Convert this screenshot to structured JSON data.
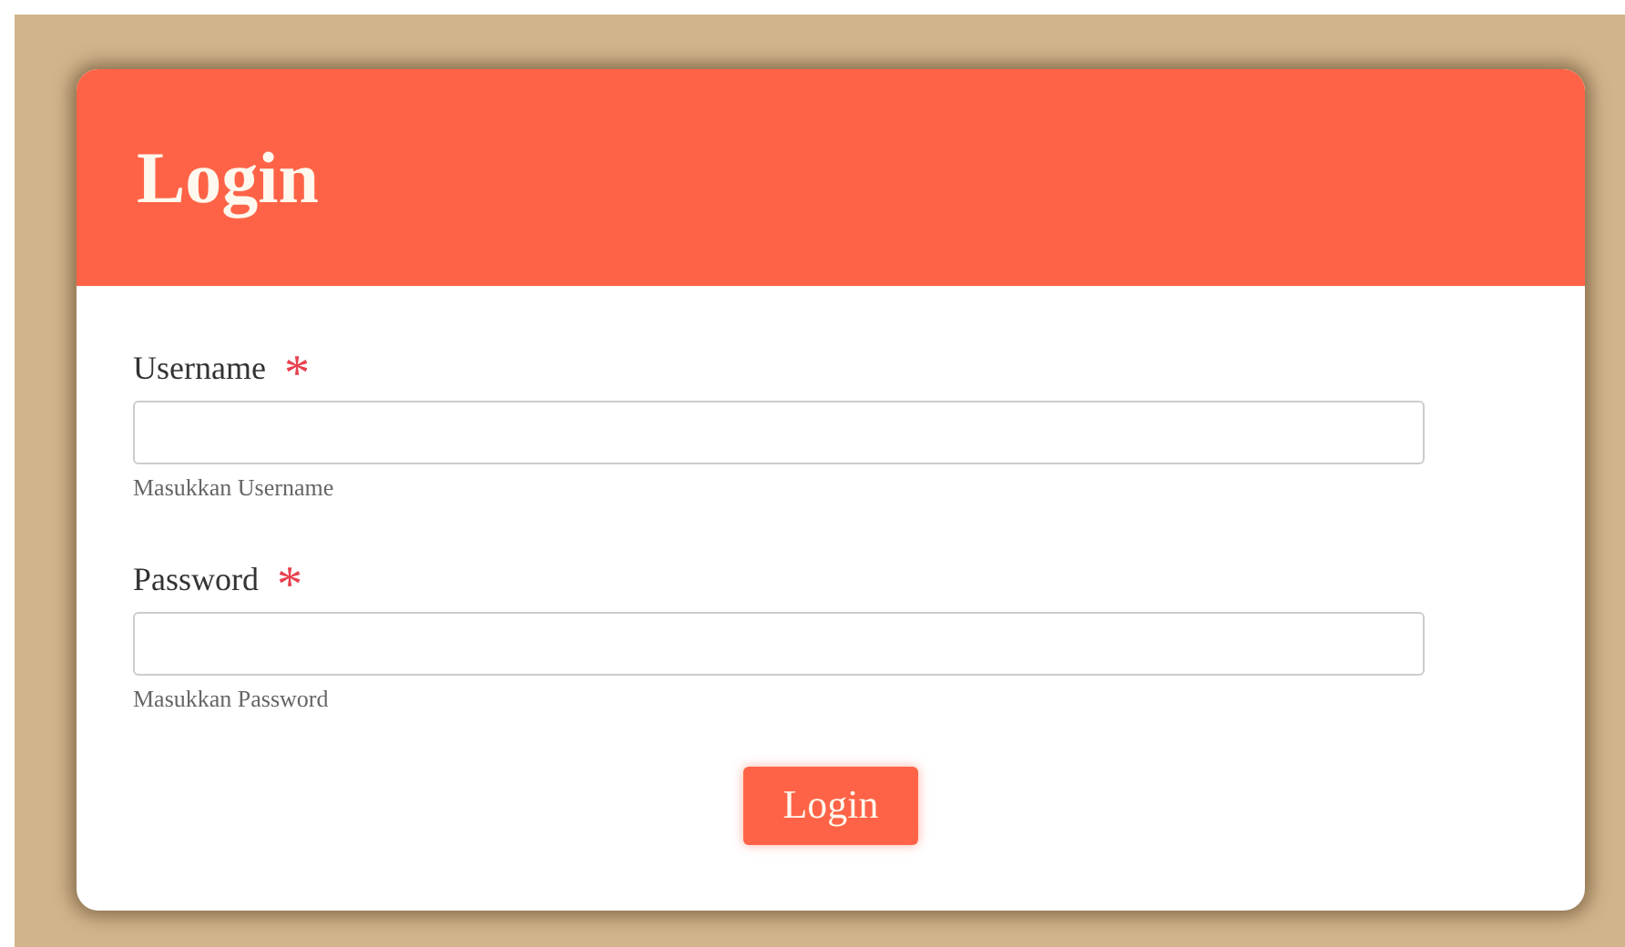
{
  "card": {
    "title": "Login"
  },
  "fields": [
    {
      "label": "Username",
      "required_mark": "*",
      "hint": "Masukkan Username"
    },
    {
      "label": "Password",
      "required_mark": "*",
      "hint": "Masukkan Password"
    }
  ],
  "submit": {
    "label": "Login"
  }
}
